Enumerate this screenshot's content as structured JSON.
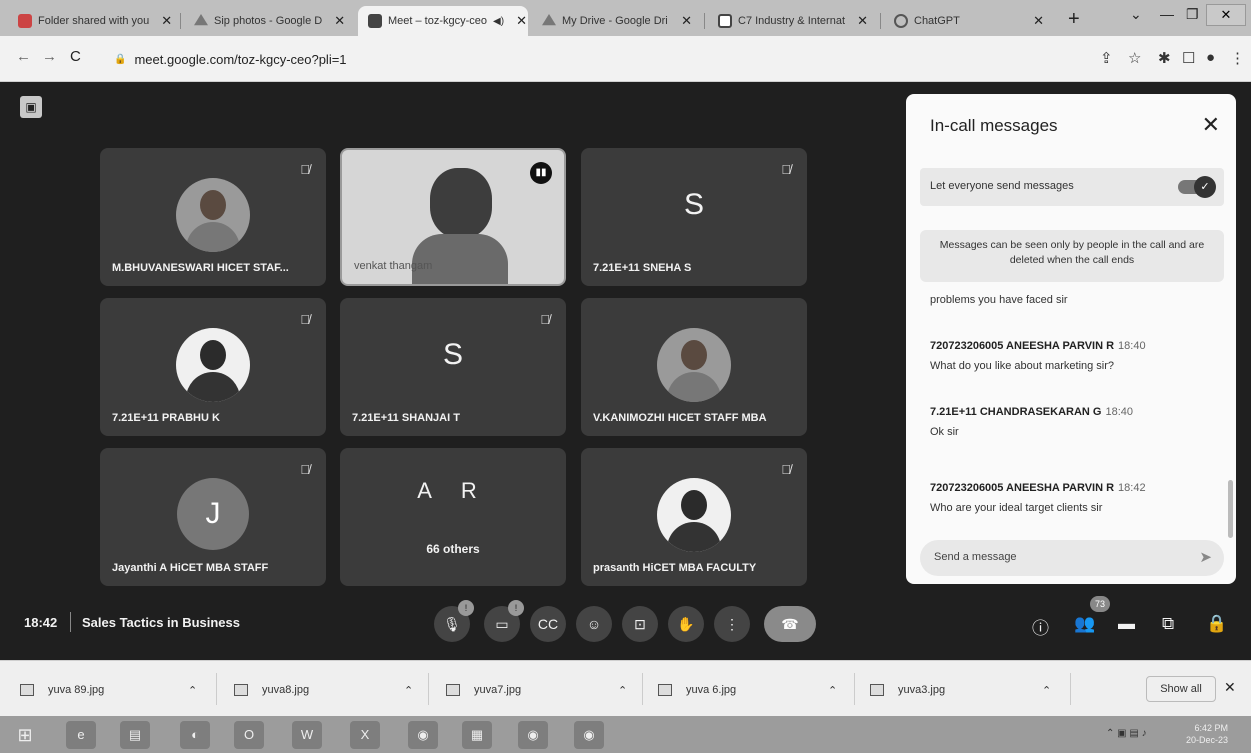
{
  "browser": {
    "tabs": [
      {
        "title": "Folder shared with you",
        "icon": "gmail-icon"
      },
      {
        "title": "Sip photos - Google D",
        "icon": "drive-icon"
      },
      {
        "title": "Meet – toz-kgcy-ceo",
        "icon": "meet-icon"
      },
      {
        "title": "My Drive - Google Dri",
        "icon": "drive-icon"
      },
      {
        "title": "C7 Industry & Internat",
        "icon": "sheets-icon"
      },
      {
        "title": "ChatGPT",
        "icon": "chatgpt-icon"
      }
    ],
    "url": "meet.google.com/toz-kgcy-ceo?pli=1"
  },
  "tiles": [
    {
      "name": "M.BHUVANESWARI HICET STAF...",
      "type": "photo"
    },
    {
      "name": "venkat thangam",
      "type": "video"
    },
    {
      "name": "7.21E+11 SNEHA S",
      "type": "letter",
      "letter": "S"
    },
    {
      "name": "7.21E+11 PRABHU K",
      "type": "photo"
    },
    {
      "name": "7.21E+11 SHANJAI T",
      "type": "letter",
      "letter": "S"
    },
    {
      "name": "V.KANIMOZHI HICET STAFF MBA",
      "type": "photo"
    },
    {
      "name": "Jayanthi A HiCET MBA STAFF",
      "type": "letter",
      "letter": "J"
    },
    {
      "name": "",
      "type": "others",
      "letters": "A R",
      "others": "66 others"
    },
    {
      "name": "prasanth HiCET MBA FACULTY",
      "type": "photo"
    }
  ],
  "chat": {
    "title": "In-call messages",
    "toggle_label": "Let everyone send messages",
    "toggle_on": true,
    "notice": "Messages can be seen only by people in the call and are deleted when the call ends",
    "partial_message": "problems you have faced sir",
    "messages": [
      {
        "sender": "720723206005 ANEESHA PARVIN R",
        "time": "18:40",
        "text": "What do you like about marketing sir?"
      },
      {
        "sender": "7.21E+11 CHANDRASEKARAN G",
        "time": "18:40",
        "text": "Ok sir"
      },
      {
        "sender": "720723206005 ANEESHA PARVIN R",
        "time": "18:42",
        "text": "Who are  your ideal target clients sir"
      }
    ],
    "input_placeholder": "Send a message"
  },
  "meeting": {
    "time": "18:42",
    "title": "Sales Tactics in Business",
    "participant_count": "73"
  },
  "downloads": {
    "items": [
      "yuva 89.jpg",
      "yuva8.jpg",
      "yuva7.jpg",
      "yuva 6.jpg",
      "yuva3.jpg"
    ],
    "show_all": "Show all"
  },
  "taskbar": {
    "time": "6:42 PM",
    "date": "20-Dec-23"
  }
}
